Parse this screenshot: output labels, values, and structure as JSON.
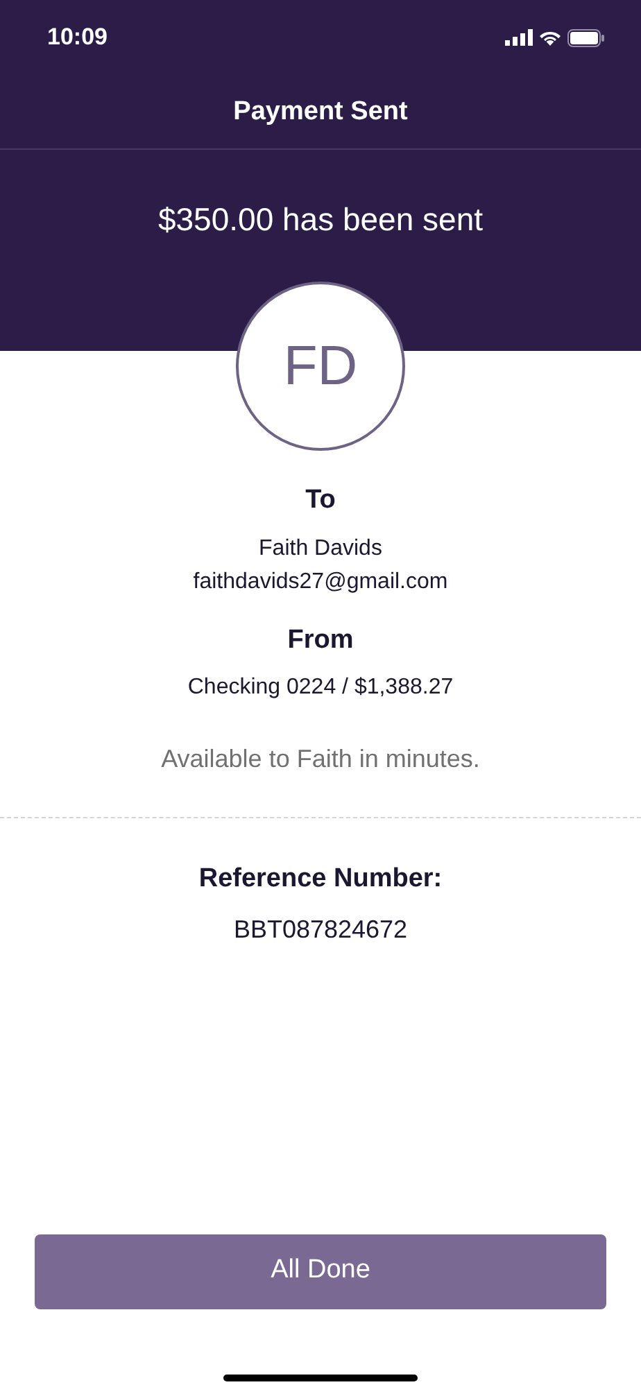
{
  "status_bar": {
    "time": "10:09"
  },
  "header": {
    "title": "Payment Sent",
    "amount_message": "$350.00 has been sent"
  },
  "recipient": {
    "initials": "FD"
  },
  "to": {
    "label": "To",
    "name": "Faith Davids",
    "email": "faithdavids27@gmail.com"
  },
  "from": {
    "label": "From",
    "account": "Checking 0224 / $1,388.27"
  },
  "availability": "Available to Faith in minutes.",
  "reference": {
    "label": "Reference Number:",
    "value": "BBT087824672"
  },
  "buttons": [
    "All Done"
  ]
}
